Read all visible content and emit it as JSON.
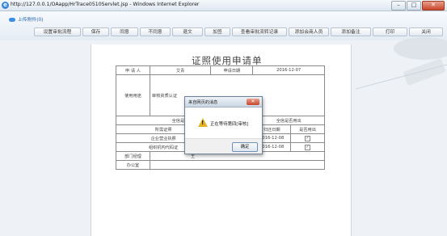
{
  "window": {
    "title": "http://127.0.0.1/OAapp/HrTrace0510Servlet.jsp - Windows Internet Explorer",
    "icon": "ie-icon",
    "minimize_label": "–",
    "maximize_label": "□",
    "close_label": "✕"
  },
  "header": {
    "upload_label": "上传附件(0)"
  },
  "toolbar": {
    "buttons": [
      "设置审批流程",
      "保存",
      "同意",
      "不同意",
      "退文",
      "加签",
      "查看审批流转记录",
      "添加会商人员",
      "添加备注",
      "打印",
      "关闭"
    ]
  },
  "document": {
    "title": "证照使用申请单",
    "rows": {
      "applicant_label": "申 请 人",
      "applicant_value": "艾青",
      "date_label": "申请日期",
      "date_value": "2016-12-07",
      "purpose_label": "使用用途",
      "purpose_value": "审核资质认证",
      "original_left": "全信是否用出",
      "original_right": "全信是否用出",
      "col_cert": "所需证照",
      "col_date": "归还日期",
      "col_return": "是否用出",
      "cert1_name": "企业营业执照",
      "cert1_date": "2016-12-08",
      "cert2_name": "组织机构代码证",
      "cert2_date": "2016-12-08",
      "dept_label": "部门经理",
      "dept_value": "王",
      "office_label": "办公室"
    }
  },
  "dialog": {
    "title": "来自网页的消息",
    "close_label": "✕",
    "message": "正在等待第四[审核]",
    "ok_label": "确定"
  }
}
